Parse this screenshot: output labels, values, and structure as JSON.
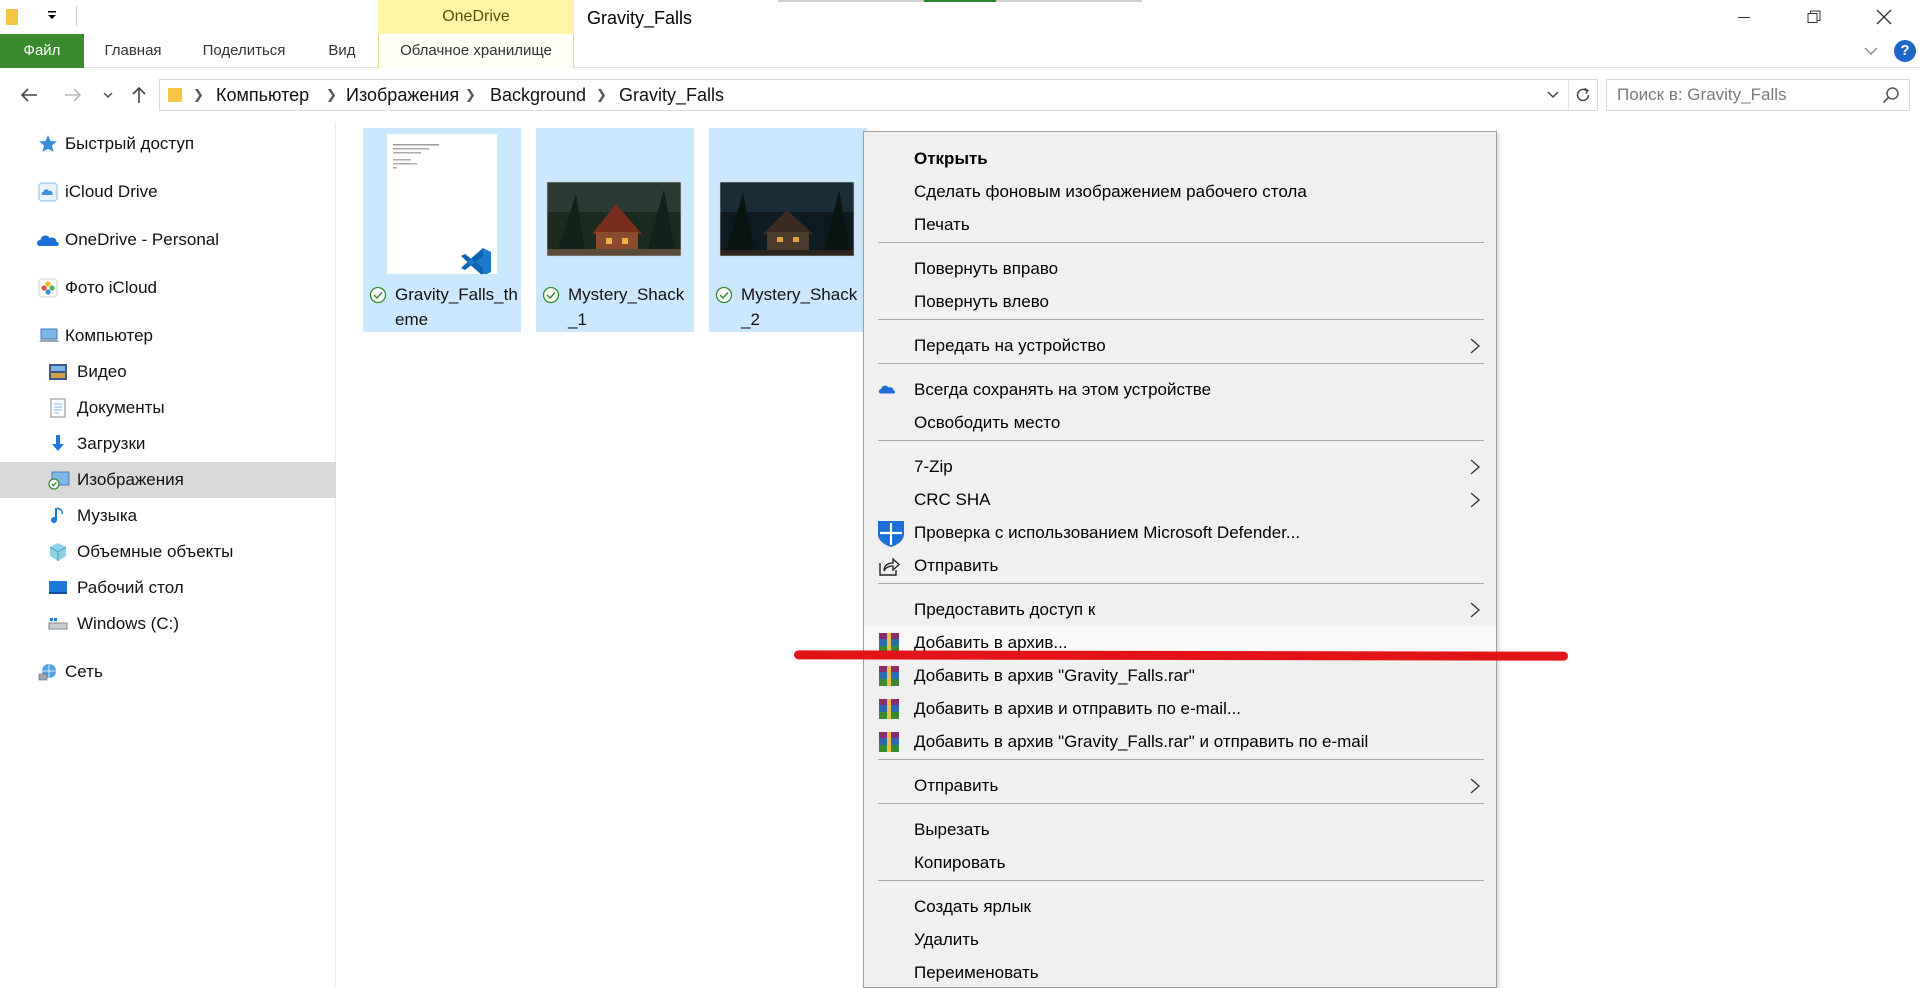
{
  "window": {
    "title": "Gravity_Falls",
    "tool_context_label": "OneDrive"
  },
  "ribbon": {
    "tabs": [
      "Файл",
      "Главная",
      "Поделиться",
      "Вид",
      "Облачное хранилище"
    ],
    "help": "?"
  },
  "address_bar": {
    "breadcrumbs": [
      "Компьютер",
      "Изображения",
      "Background",
      "Gravity_Falls"
    ]
  },
  "search": {
    "placeholder": "Поиск в: Gravity_Falls"
  },
  "nav_pane": {
    "items": [
      {
        "label": "Быстрый доступ",
        "icon": "star-icon"
      },
      {
        "label": "iCloud Drive",
        "icon": "icloud-drive-icon"
      },
      {
        "label": "OneDrive - Personal",
        "icon": "onedrive-cloud-icon"
      },
      {
        "label": "Фото iCloud",
        "icon": "icloud-photos-icon"
      },
      {
        "label": "Компьютер",
        "icon": "computer-icon"
      },
      {
        "label": "Видео",
        "icon": "video-folder-icon"
      },
      {
        "label": "Документы",
        "icon": "documents-folder-icon"
      },
      {
        "label": "Загрузки",
        "icon": "downloads-arrow-icon"
      },
      {
        "label": "Изображения",
        "icon": "pictures-folder-icon",
        "selected": true
      },
      {
        "label": "Музыка",
        "icon": "music-note-icon"
      },
      {
        "label": "Объемные объекты",
        "icon": "3d-objects-icon"
      },
      {
        "label": "Рабочий стол",
        "icon": "desktop-folder-icon"
      },
      {
        "label": "Windows (C:)",
        "icon": "drive-icon"
      },
      {
        "label": "Сеть",
        "icon": "network-icon"
      }
    ]
  },
  "files": [
    {
      "name": "Gravity_Falls_theme",
      "type": "vscode-theme",
      "synced": true,
      "selected": true
    },
    {
      "name": "Mystery_Shack_1",
      "type": "image",
      "synced": true,
      "selected": true
    },
    {
      "name": "Mystery_Shack_2",
      "type": "image",
      "synced": true,
      "selected": true
    }
  ],
  "context_menu": {
    "items": [
      {
        "label": "Открыть",
        "bold": true
      },
      {
        "label": "Сделать фоновым изображением рабочего стола"
      },
      {
        "label": "Печать"
      },
      {
        "label": "Повернуть вправо"
      },
      {
        "label": "Повернуть влево"
      },
      {
        "label": "Передать на устройство",
        "submenu": true
      },
      {
        "label": "Всегда сохранять на этом устройстве",
        "icon": "onedrive-cloud-icon"
      },
      {
        "label": "Освободить место"
      },
      {
        "label": "7-Zip",
        "submenu": true
      },
      {
        "label": "CRC SHA",
        "submenu": true
      },
      {
        "label": "Проверка с использованием Microsoft Defender...",
        "icon": "defender-shield-icon"
      },
      {
        "label": "Отправить",
        "icon": "share-icon"
      },
      {
        "label": "Предоставить доступ к",
        "submenu": true
      },
      {
        "label": "Добавить в архив...",
        "icon": "winrar-icon",
        "highlighted": true
      },
      {
        "label": "Добавить в архив \"Gravity_Falls.rar\"",
        "icon": "winrar-icon"
      },
      {
        "label": "Добавить в архив и отправить по e-mail...",
        "icon": "winrar-icon"
      },
      {
        "label": "Добавить в архив \"Gravity_Falls.rar\" и отправить по e-mail",
        "icon": "winrar-icon"
      },
      {
        "label": "Отправить",
        "submenu": true
      },
      {
        "label": "Вырезать"
      },
      {
        "label": "Копировать"
      },
      {
        "label": "Создать ярлык"
      },
      {
        "label": "Удалить"
      },
      {
        "label": "Переименовать"
      }
    ]
  },
  "colors": {
    "file_tab": "#3a8a2e",
    "selection": "#cce8ff",
    "nav_selected": "#d9d9d9",
    "menu_bg": "#f0f0f0",
    "annotation": "#e3131a",
    "onedrive_context": "#fef5a7"
  }
}
